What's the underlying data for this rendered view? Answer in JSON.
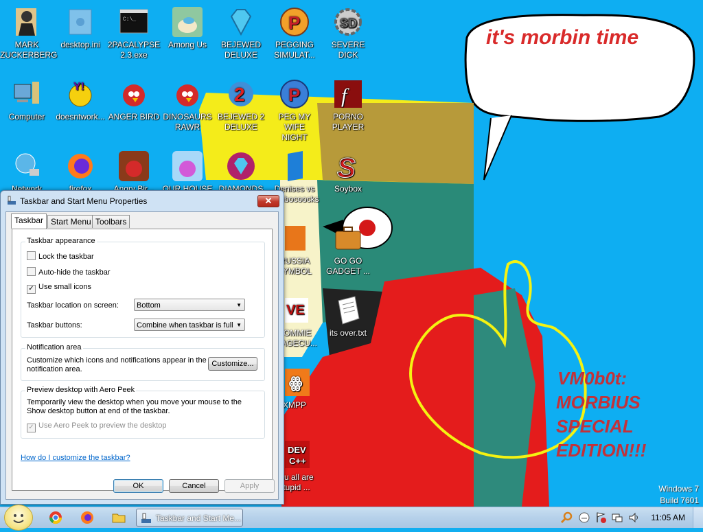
{
  "desktop": {
    "wallpaper": {
      "speech_text": "it's morbin time",
      "caption_lines": [
        "VM0b0t:",
        "MORBIUS",
        "SPECIAL",
        "EDITION!!!"
      ]
    },
    "watermark": {
      "line1": "Windows 7",
      "line2": "Build 7601"
    },
    "icons": [
      {
        "label": "MARK\nZUCKERBERG",
        "icon": "person-icon"
      },
      {
        "label": "desktop.ini",
        "icon": "settings-file-icon"
      },
      {
        "label": "2PACALYPSE\n2.3.exe",
        "icon": "console-icon"
      },
      {
        "label": "Among Us",
        "icon": "among-us-icon"
      },
      {
        "label": "BEJEWED\nDELUXE",
        "icon": "gem-icon"
      },
      {
        "label": "PEGGING\nSIMULAT...",
        "icon": "p-logo-icon"
      },
      {
        "label": "SEVERE DICK",
        "icon": "gear-sd-icon"
      },
      {
        "label": "Computer",
        "icon": "computer-icon"
      },
      {
        "label": "doesntwork...",
        "icon": "yahoo-icon"
      },
      {
        "label": "ANGER BIRD",
        "icon": "angry-bird-icon"
      },
      {
        "label": "DINOSAURS\nRAWR",
        "icon": "angry-bird-icon"
      },
      {
        "label": "BEJEWED 2\nDELUXE",
        "icon": "gem-2-icon"
      },
      {
        "label": "PEG MY WIFE\nNIGHT",
        "icon": "p-logo-icon"
      },
      {
        "label": "PORNO\nPLAYER",
        "icon": "flash-icon"
      },
      {
        "label": "Network",
        "icon": "network-icon"
      },
      {
        "label": "firefox",
        "icon": "firefox-icon"
      },
      {
        "label": "Angry Bir...",
        "icon": "angry-bird-seasons-icon"
      },
      {
        "label": "OUR HOUSE",
        "icon": "bird-icon"
      },
      {
        "label": "DIAMONDS",
        "icon": "gem-icon"
      },
      {
        "label": "Denises vs\nBimbocoocks",
        "icon": "blue-book-icon"
      },
      {
        "label": "Soybox",
        "icon": "soybox-icon"
      },
      {
        "label": "RUSSIA\nSYMBOL",
        "icon": "orange-box-icon"
      },
      {
        "label": "GO GO\nGADGET ...",
        "icon": "briefcase-icon"
      },
      {
        "label": "COMMIE\nIMAGECU...",
        "icon": "commie-icon"
      },
      {
        "label": "its over.txt",
        "icon": "text-file-icon"
      },
      {
        "label": "XMPP",
        "icon": "xampp-icon"
      },
      {
        "label": "you all are\nstupid ...",
        "icon": "devcpp-icon"
      }
    ]
  },
  "dialog": {
    "title": "Taskbar and Start Menu Properties",
    "tabs": [
      {
        "label": "Taskbar",
        "active": true
      },
      {
        "label": "Start Menu"
      },
      {
        "label": "Toolbars"
      }
    ],
    "appearance": {
      "title": "Taskbar appearance",
      "lock": {
        "label": "Lock the taskbar",
        "checked": false
      },
      "autohide": {
        "label": "Auto-hide the taskbar",
        "checked": false
      },
      "small_icons": {
        "label": "Use small icons",
        "checked": true
      },
      "location_label": "Taskbar location on screen:",
      "location_value": "Bottom",
      "buttons_label": "Taskbar buttons:",
      "buttons_value": "Combine when taskbar is full"
    },
    "notification": {
      "title": "Notification area",
      "text": "Customize which icons and notifications appear in the notification area.",
      "button": "Customize..."
    },
    "peek": {
      "title": "Preview desktop with Aero Peek",
      "text": "Temporarily view the desktop when you move your mouse to the Show desktop button at end of the taskbar.",
      "checkbox": {
        "label": "Use Aero Peek to preview the desktop",
        "checked": true,
        "disabled": true
      }
    },
    "help_link": "How do I customize the taskbar?",
    "buttons": {
      "ok": "OK",
      "cancel": "Cancel",
      "apply": "Apply"
    }
  },
  "taskbar": {
    "active_task": "Taskbar and Start Me...",
    "clock": "11:05 AM"
  }
}
